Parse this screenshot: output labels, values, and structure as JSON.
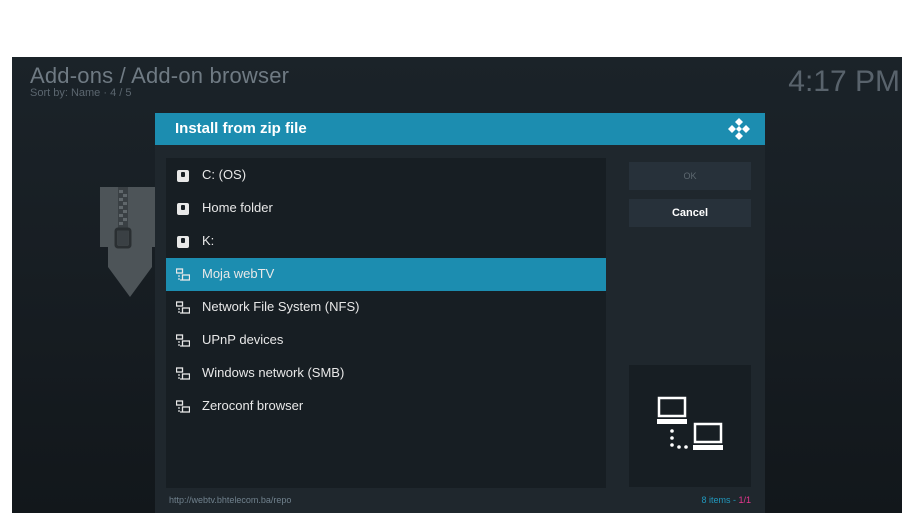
{
  "header": {
    "breadcrumb": "Add-ons / Add-on browser",
    "sort_info": "Sort by: Name · 4 / 5",
    "clock": "4:17 PM"
  },
  "dialog": {
    "title": "Install from zip file",
    "items": [
      {
        "label": "C: (OS)",
        "icon": "drive-icon",
        "selected": false
      },
      {
        "label": "Home folder",
        "icon": "drive-icon",
        "selected": false
      },
      {
        "label": "K:",
        "icon": "drive-icon",
        "selected": false
      },
      {
        "label": "Moja webTV",
        "icon": "network-icon",
        "selected": true
      },
      {
        "label": "Network File System (NFS)",
        "icon": "network-icon",
        "selected": false
      },
      {
        "label": "UPnP devices",
        "icon": "network-icon",
        "selected": false
      },
      {
        "label": "Windows network (SMB)",
        "icon": "network-icon",
        "selected": false
      },
      {
        "label": "Zeroconf browser",
        "icon": "network-icon",
        "selected": false
      }
    ],
    "ok_label": "OK",
    "cancel_label": "Cancel",
    "footer_path": "http://webtv.bhtelecom.ba/repo",
    "footer_count_items": "8 items - ",
    "footer_count_page": "1/1"
  },
  "colors": {
    "accent": "#1c8db0",
    "dialog_bg": "#1f272d",
    "list_bg": "#171e23"
  }
}
